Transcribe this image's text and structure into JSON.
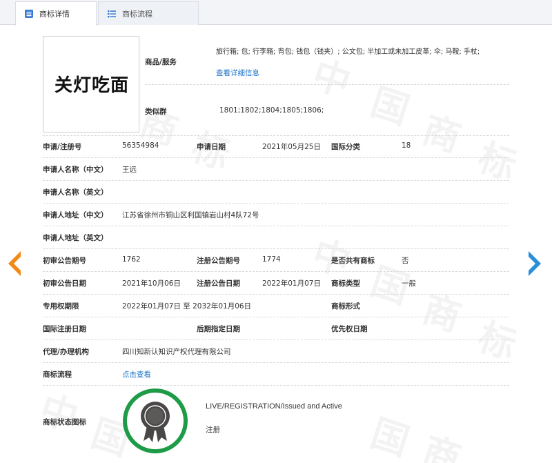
{
  "tabs": [
    {
      "label": "商标详情",
      "active": true,
      "icon": "document-list-icon"
    },
    {
      "label": "商标流程",
      "active": false,
      "icon": "flow-list-icon"
    }
  ],
  "trademark_image_text": "关灯吃面",
  "watermark": [
    "中",
    "国",
    "商",
    "标"
  ],
  "goods": {
    "label": "商品/服务",
    "value": "旅行箱; 包; 行李箱; 背包; 钱包（钱夹）; 公文包; 半加工或未加工皮革; 伞; 马鞍; 手杖;",
    "detail_link": "查看详细信息"
  },
  "similar_group": {
    "label": "类似群",
    "value": "1801;1802;1804;1805;1806;"
  },
  "fields": {
    "reg_no_label": "申请/注册号",
    "reg_no": "56354984",
    "apply_date_label": "申请日期",
    "apply_date": "2021年05月25日",
    "intl_class_label": "国际分类",
    "intl_class": "18",
    "applicant_cn_label": "申请人名称（中文）",
    "applicant_cn": "王远",
    "applicant_en_label": "申请人名称（英文）",
    "applicant_en": "",
    "address_cn_label": "申请人地址（中文）",
    "address_cn": "江苏省徐州市铜山区利国镇岩山村4队72号",
    "address_en_label": "申请人地址（英文）",
    "address_en": "",
    "prelim_no_label": "初审公告期号",
    "prelim_no": "1762",
    "reg_pub_no_label": "注册公告期号",
    "reg_pub_no": "1774",
    "shared_label": "是否共有商标",
    "shared": "否",
    "prelim_date_label": "初审公告日期",
    "prelim_date": "2021年10月06日",
    "reg_pub_date_label": "注册公告日期",
    "reg_pub_date": "2022年01月07日",
    "mark_type_label": "商标类型",
    "mark_type": "一般",
    "exclusive_label": "专用权期限",
    "exclusive": "2022年01月07日 至 2032年01月06日",
    "mark_form_label": "商标形式",
    "mark_form": "",
    "intl_reg_date_label": "国际注册日期",
    "intl_reg_date": "",
    "later_date_label": "后期指定日期",
    "later_date": "",
    "priority_date_label": "优先权日期",
    "priority_date": "",
    "agency_label": "代理/办理机构",
    "agency": "四川知新认知识产权代理有限公司",
    "flow_label": "商标流程",
    "flow_link": "点击查看",
    "status_icon_label": "商标状态图标",
    "status_en": "LIVE/REGISTRATION/Issued and Active",
    "status_cn": "注册"
  },
  "icons": {
    "prev": "chevron-left-icon",
    "next": "chevron-right-icon",
    "status_badge": "registered-seal-icon"
  },
  "colors": {
    "link": "#1a73c8",
    "prev_arrow": "#f28a1a",
    "next_arrow": "#2b8fd6",
    "badge_ring": "#1e9b46",
    "badge_seal": "#4a4747"
  }
}
